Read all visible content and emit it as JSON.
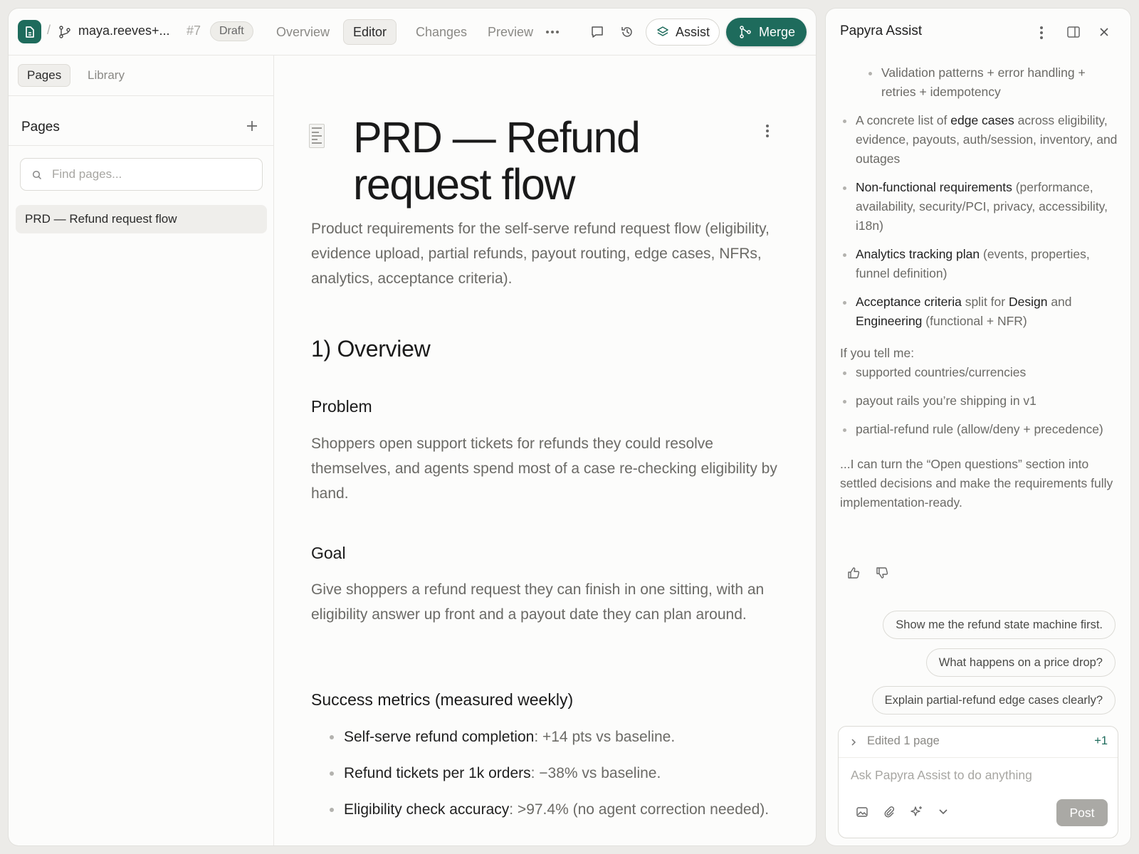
{
  "topbar": {
    "branch": "maya.reeves+...",
    "pr_number": "#7",
    "status": "Draft",
    "tabs": [
      "Overview",
      "Editor",
      "Changes",
      "Preview"
    ],
    "assist_label": "Assist",
    "merge_label": "Merge"
  },
  "sidebar": {
    "tabs": [
      "Pages",
      "Library"
    ],
    "heading": "Pages",
    "search_placeholder": "Find pages...",
    "items": [
      "PRD — Refund request flow"
    ]
  },
  "document": {
    "title": "PRD — Refund request flow",
    "lead": "Product requirements for the self-serve refund request flow (eligibility, evidence upload, partial refunds, payout routing, edge cases, NFRs, analytics, acceptance criteria).",
    "section_overview": "1) Overview",
    "problem_heading": "Problem",
    "problem_text": "Shoppers open support tickets for refunds they could resolve themselves, and agents spend most of a case re-checking eligibility by hand.",
    "goal_heading": "Goal",
    "goal_text": "Give shoppers a refund request they can finish in one sitting, with an eligibility answer up front and a payout date they can plan around.",
    "metrics_heading": "Success metrics (measured weekly)",
    "metrics": [
      {
        "label": "Self-serve refund completion",
        "text": ": +14 pts vs baseline."
      },
      {
        "label": "Refund tickets per 1k orders",
        "text": ": −38% vs baseline."
      },
      {
        "label": "Eligibility check accuracy",
        "text": ": >97.4% (no agent correction needed)."
      }
    ]
  },
  "assist": {
    "title": "Papyra Assist",
    "sub_bullet": "Validation patterns + error handling + retries + idempotency",
    "bullets": [
      {
        "pre": "A concrete list of ",
        "bold": "edge cases",
        "post": " across eligibility, evidence, payouts, auth/session, inventory, and outages"
      },
      {
        "pre": "",
        "bold": "Non-functional requirements",
        "post": " (performance, availability, security/PCI, privacy, accessibility, i18n)"
      },
      {
        "pre": "",
        "bold": "Analytics tracking plan",
        "post": " (events, properties, funnel definition)"
      }
    ],
    "acceptance": {
      "b1": "Acceptance criteria",
      "t1": " split for ",
      "b2": "Design",
      "t2": " and ",
      "b3": "Engineering",
      "t3": " (functional + NFR)"
    },
    "ask_intro": "If you tell me:",
    "asks": [
      "supported countries/currencies",
      "payout rails you’re shipping in v1",
      "partial-refund rule (allow/deny + precedence)"
    ],
    "closing": "...I can turn the “Open questions” section into settled decisions and make the requirements fully implementation-ready.",
    "suggestions": [
      "Show me the refund state machine first.",
      "What happens on a price drop?",
      "Explain partial-refund edge cases clearly?"
    ],
    "edited_label": "Edited 1 page",
    "edited_count": "+1",
    "composer_placeholder": "Ask Papyra Assist to do anything",
    "post_label": "Post"
  },
  "colors": {
    "accent": "#1e6b5c",
    "panel": "#fcfcfb",
    "background": "#ecebe8"
  },
  "icons": [
    "document-icon",
    "branch-icon",
    "more-icon",
    "comment-icon",
    "history-icon",
    "layers-icon",
    "merge-icon",
    "plus-icon",
    "search-icon",
    "kebab-icon",
    "sidebar-toggle-icon",
    "close-icon",
    "thumbs-up-icon",
    "thumbs-down-icon",
    "chevron-right-icon",
    "image-icon",
    "paperclip-icon",
    "sparkle-icon",
    "chevron-down-icon"
  ]
}
